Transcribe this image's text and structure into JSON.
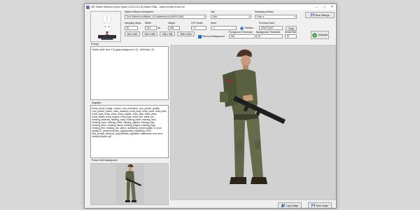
{
  "window": {
    "title": "MR Stable Diffusion Quick Sprite 24.02.04.0 by Mauro Rifla - https://mrsternn.itch.io/"
  },
  "checkpoint": {
    "label": "Stable Diffusion checkpoint",
    "value": "Toon Babes toonBabes_v10.safetensors [c5647c109f]"
  },
  "vae": {
    "label": "Vae",
    "value": "Auto"
  },
  "sampling_method": {
    "label": "Sampling method",
    "value": "Euler a"
  },
  "save_settings_label": "Save Settings",
  "sampling_steps": {
    "label": "Sampling Steps",
    "value": "30"
  },
  "width": {
    "label": "Width",
    "value": "512"
  },
  "height": {
    "label": "Height",
    "value": "768"
  },
  "cfg_scale": {
    "label": "CFG Scale",
    "value": "7.0"
  },
  "seed": {
    "label": "Seed",
    "value": "-1"
  },
  "random_label": "Random",
  "previous_seed": {
    "label": "Previous Seed",
    "value": "3784731627"
  },
  "copy_label": "Copy",
  "size_presets": [
    "512 x 512",
    "512 x 768",
    "768 x 768",
    "768 x 1024"
  ],
  "remove_background_label": "Remove Background",
  "foreground_threshold": {
    "label": "Foreground Threshold",
    "value": "240"
  },
  "background_threshold": {
    "label": "Background Threshold",
    "value": "10"
  },
  "erode_size": {
    "label": "Erode Size",
    "value": "10"
  },
  "generate_label": "Generate",
  "prompt": {
    "label": "Prompt",
    "text": "Soldier (side view 1.3) (gray background 1.3) . (full body 1.3)"
  },
  "negative": {
    "label": "Negative",
    "text": "blurry, blurry_image, Lowres, Low_resolution, Low_picture_quality, Low_picture_anime, extra_anatomy, extra_body, extra_navel, extra_face, extra_eyes, extra_chest, extra_nipples, extra_hips, extra_arms, extra_hands, extra_fingers, extra_legs, extra_feet, extra_toe, missing_anatomy, missing_body, missing_navel, missing_face, missing_eyes, missing_chest, missing_nipples, missing_hips, missing_arms, missing_hands, missing_fingers, missing_legs, missing_feet, missing_toe, sketch, sketching, (worst quality: 2), (low quality:2), ((monochrome)), ((grayscale)), inpainting, HDR, bad_prompt_version2, jpeg artifacts, signature, watermark, text, error, missing fingers, gif"
  },
  "picture_with_background_label": "Picture with Background",
  "copy_image_label": "Copy Image",
  "save_image_label": "Save Image",
  "colors": {
    "accent": "#1565c0",
    "generate_icon": "#2e9d3a",
    "preview_bg": "#d1d1d1"
  }
}
